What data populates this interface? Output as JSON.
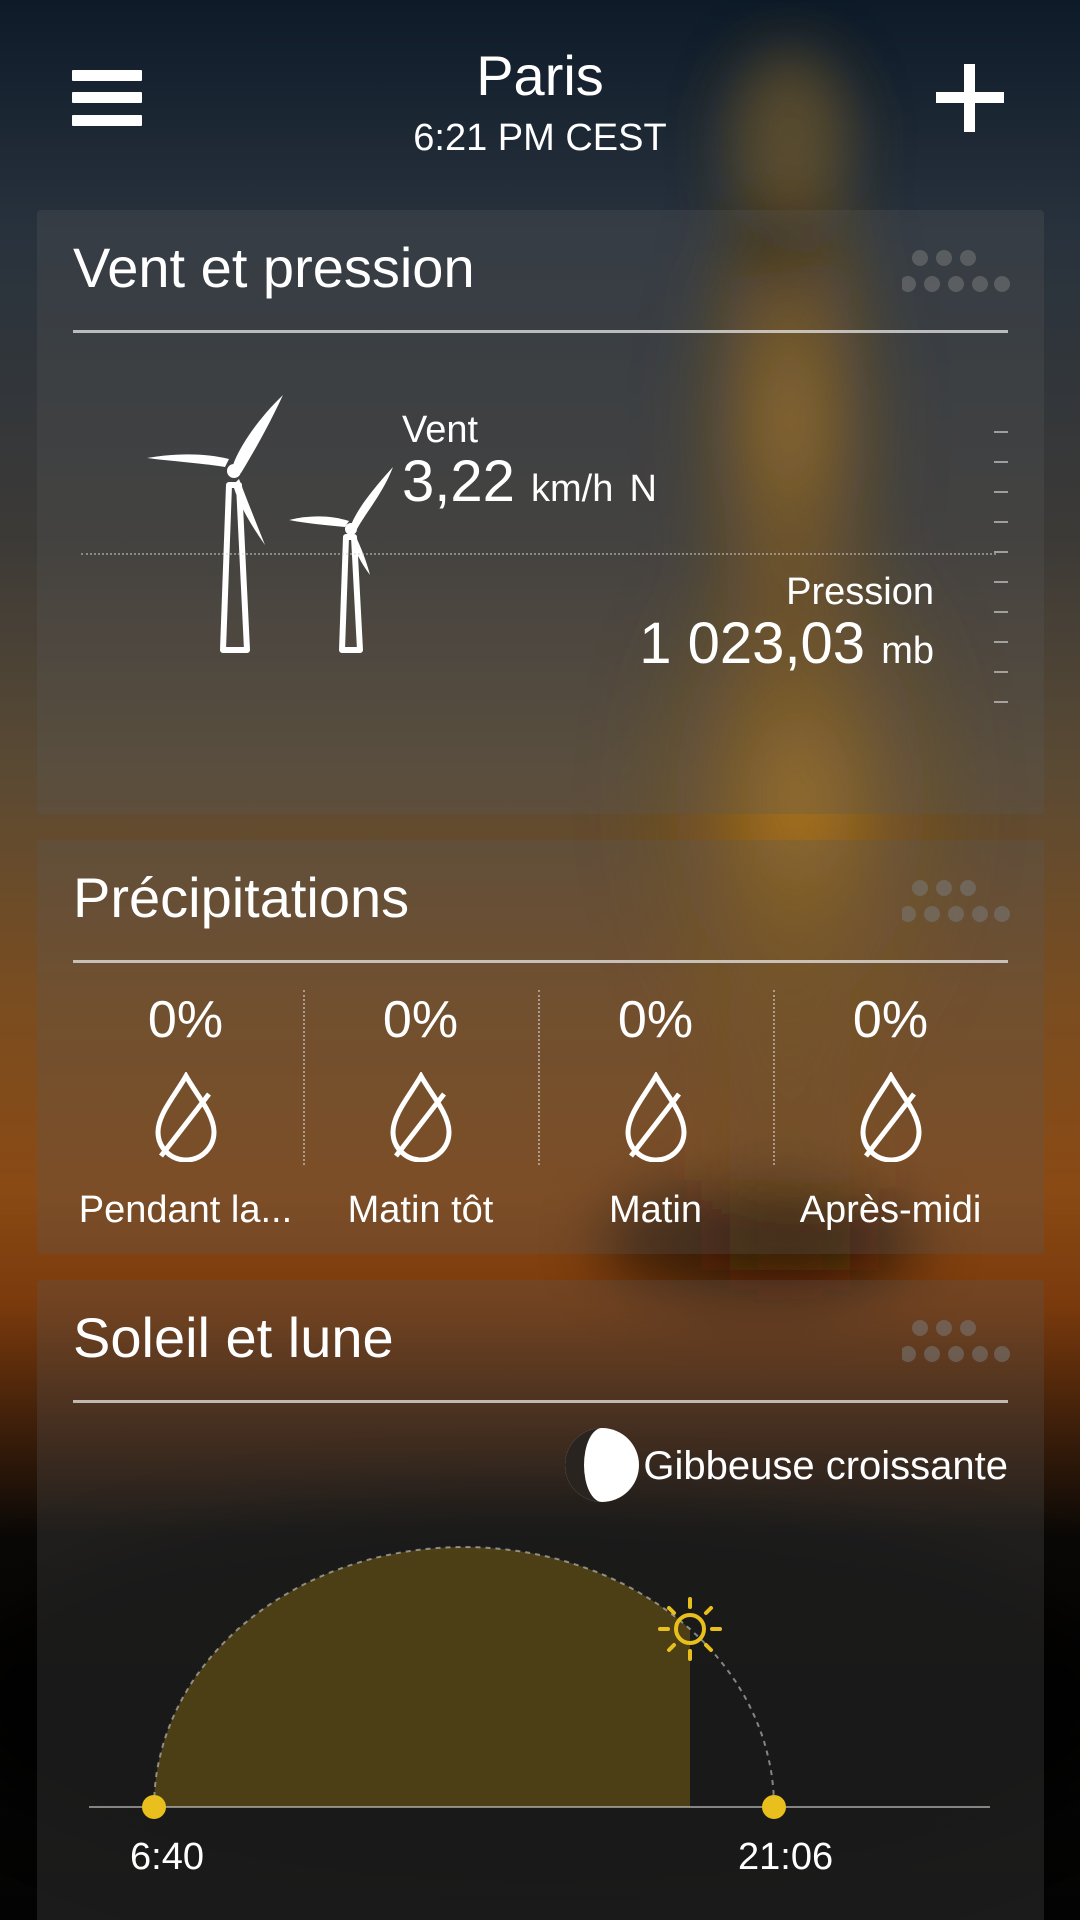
{
  "header": {
    "city": "Paris",
    "time": "6:21 PM CEST",
    "menu_icon": "hamburger-menu-icon",
    "add_icon": "plus-icon"
  },
  "wind_pressure": {
    "title": "Vent et pression",
    "wind_label": "Vent",
    "wind_value": "3,22",
    "wind_unit": "km/h",
    "wind_direction": "N",
    "pressure_label": "Pression",
    "pressure_value": "1 023,03",
    "pressure_unit": "mb",
    "icon": "wind-turbines-icon"
  },
  "precipitation": {
    "title": "Précipitations",
    "periods": [
      {
        "percent": "0%",
        "label": "Pendant la..."
      },
      {
        "percent": "0%",
        "label": "Matin tôt"
      },
      {
        "percent": "0%",
        "label": "Matin"
      },
      {
        "percent": "0%",
        "label": "Après-midi"
      }
    ],
    "icon": "raindrop-no-rain-icon"
  },
  "sun_moon": {
    "title": "Soleil et lune",
    "moon_phase": "Gibbeuse croissante",
    "moon_icon": "waxing-gibbous-moon-icon",
    "sunrise": "6:40",
    "sunset": "21:06",
    "sun_icon": "sun-icon",
    "daylight_elapsed_fraction": 0.76
  },
  "colors": {
    "accent_yellow": "#e8bf1c",
    "card_background": "rgba(90,90,90,0.28)",
    "text": "#ffffff"
  }
}
